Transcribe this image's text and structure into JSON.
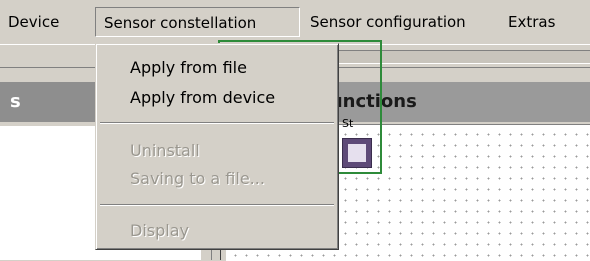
{
  "menubar": {
    "items": [
      "Device",
      "Sensor constellation",
      "Sensor configuration",
      "Extras"
    ]
  },
  "dropdown": {
    "items": [
      {
        "label": "Apply from file",
        "enabled": true
      },
      {
        "label": "Apply from device",
        "enabled": true
      },
      {
        "label": "Uninstall",
        "enabled": false
      },
      {
        "label": "Saving to a file...",
        "enabled": false
      },
      {
        "label": "Display",
        "enabled": false
      }
    ]
  },
  "left_panel": {
    "header_fragment": "s"
  },
  "right_panel": {
    "header": "functions",
    "block_label": "St"
  },
  "colors": {
    "menu_background": "#d4d0c8",
    "function_box_border": "#2e8b3a",
    "block_tile": "#5e4a78"
  }
}
